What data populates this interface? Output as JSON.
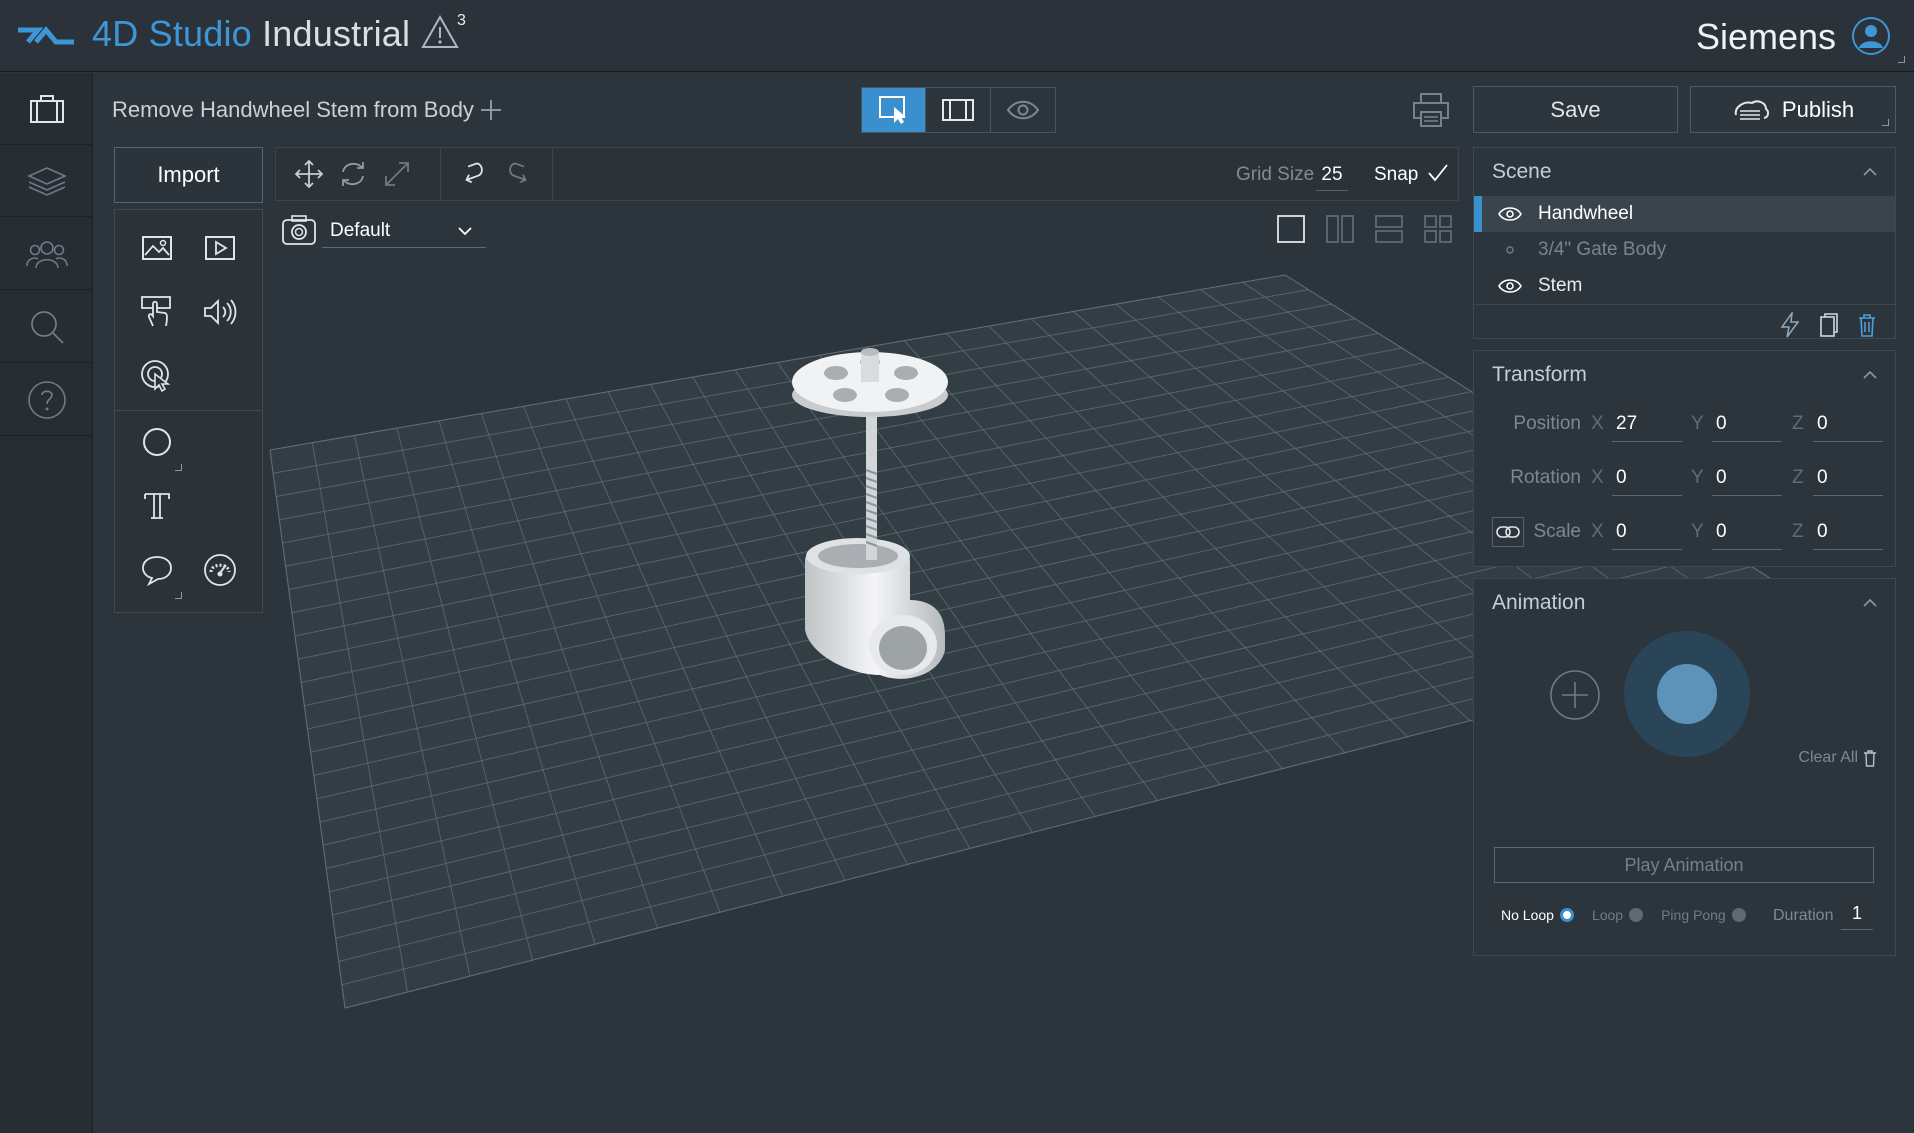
{
  "app": {
    "title_strong": "4D Studio",
    "title_light": "Industrial",
    "alert_count": "3",
    "user_name": "Siemens",
    "accent_color": "#3a8fcf"
  },
  "rail": {
    "items": [
      {
        "icon": "briefcase-icon"
      },
      {
        "icon": "layers-icon"
      },
      {
        "icon": "users-icon"
      },
      {
        "icon": "search-icon"
      },
      {
        "icon": "help-icon"
      }
    ]
  },
  "doc": {
    "title": "Remove Handwheel Stem from Body",
    "modes": [
      "select-mode",
      "preview-mode",
      "view-mode"
    ],
    "active_mode": 0
  },
  "actions": {
    "save_label": "Save",
    "publish_label": "Publish"
  },
  "import": {
    "label": "Import"
  },
  "toolbar": {
    "grid_label": "Grid Size",
    "grid_value": "25",
    "snap_label": "Snap"
  },
  "camera": {
    "selected": "Default"
  },
  "scene": {
    "header": "Scene",
    "items": [
      {
        "label": "Handwheel",
        "visible": true,
        "selected": true
      },
      {
        "label": "3/4\" Gate Body",
        "visible": false,
        "selected": false
      },
      {
        "label": "Stem",
        "visible": true,
        "selected": false
      }
    ]
  },
  "transform": {
    "header": "Transform",
    "position_label": "Position",
    "rotation_label": "Rotation",
    "scale_label": "Scale",
    "axis_x": "X",
    "axis_y": "Y",
    "axis_z": "Z",
    "position": {
      "x": "27",
      "y": "0",
      "z": "0"
    },
    "rotation": {
      "x": "0",
      "y": "0",
      "z": "0"
    },
    "scale": {
      "x": "0",
      "y": "0",
      "z": "0"
    }
  },
  "animation": {
    "header": "Animation",
    "clear_all": "Clear All",
    "play_label": "Play Animation",
    "loop_options": [
      "No Loop",
      "Loop",
      "Ping Pong"
    ],
    "loop_selected": "No Loop",
    "duration_label": "Duration",
    "duration_value": "1"
  }
}
